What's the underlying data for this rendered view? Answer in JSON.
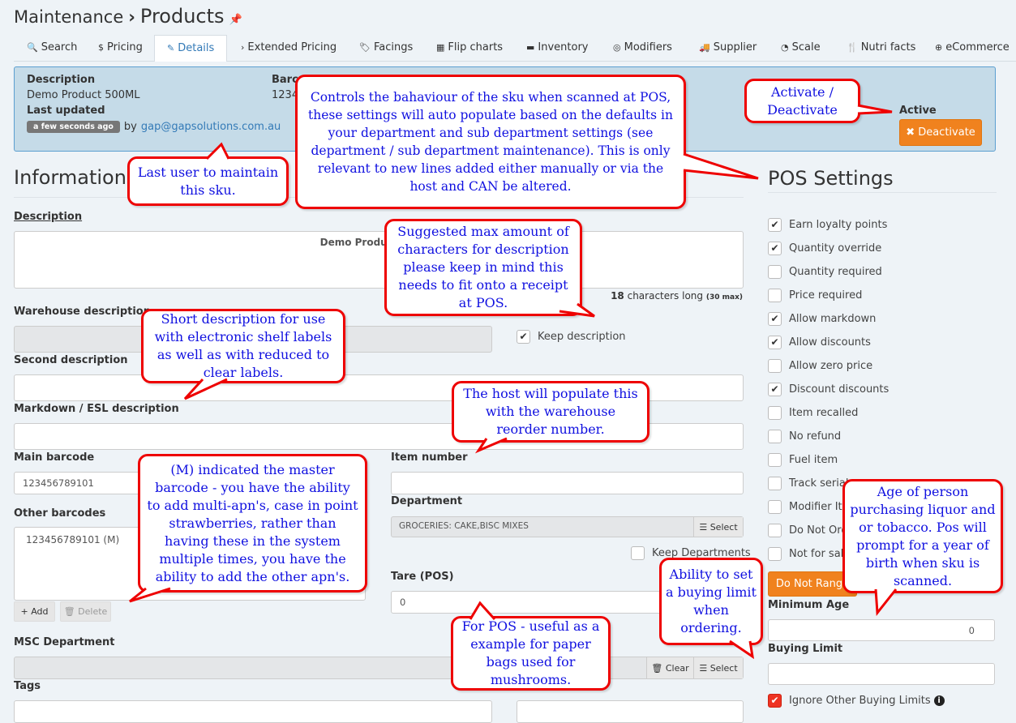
{
  "breadcrumb": {
    "parent": "Maintenance",
    "separator": "›",
    "current": "Products"
  },
  "tabs": [
    {
      "icon": "🔍",
      "label": "Search"
    },
    {
      "icon": "$",
      "label": "Pricing"
    },
    {
      "icon": "✎",
      "label": "Details"
    },
    {
      "icon": "›",
      "label": "Extended Pricing"
    },
    {
      "icon": "🏷",
      "label": "Facings"
    },
    {
      "icon": "▦",
      "label": "Flip charts"
    },
    {
      "icon": "▬",
      "label": "Inventory"
    },
    {
      "icon": "◎",
      "label": "Modifiers"
    },
    {
      "icon": "🚚",
      "label": "Supplier"
    },
    {
      "icon": "◔",
      "label": "Scale"
    },
    {
      "icon": "🍴",
      "label": "Nutri facts"
    },
    {
      "icon": "⊕",
      "label": "eCommerce"
    }
  ],
  "active_tab": "Details",
  "summary": {
    "description_label": "Description",
    "description": "Demo Product 500ML",
    "barcode_label": "Barcode",
    "barcode": "123456789101",
    "last_updated_label": "Last updated",
    "last_updated": "a few seconds ago",
    "by": "by",
    "user": "gap@gapsolutions.com.au",
    "status_label": "Active",
    "deactivate_button": "✖ Deactivate"
  },
  "information": {
    "title": "Information",
    "description_label": "Description",
    "description_value": "Demo Product 500ML",
    "char_count": "18",
    "char_text": "characters long",
    "char_max": "(30 max)",
    "warehouse_label": "Warehouse description",
    "keep_description": "Keep description",
    "second_label": "Second description",
    "markdown_label": "Markdown / ESL description",
    "main_barcode_label": "Main barcode",
    "main_barcode": "123456789101",
    "item_number_label": "Item number",
    "other_barcodes_label": "Other barcodes",
    "other_barcodes": [
      "123456789101 (M)"
    ],
    "add_button": "+ Add",
    "delete_button": "🗑 Delete",
    "department_label": "Department",
    "department": "GROCERIES: CAKE,BISC MIXES",
    "select_button": "☰ Select",
    "keep_departments": "Keep Departments",
    "tare_label": "Tare (POS)",
    "tare": "0",
    "msc_label": "MSC Department",
    "clear_button": "🗑 Clear",
    "tags_label": "Tags"
  },
  "pos": {
    "title": "POS Settings",
    "options": [
      {
        "label": "Earn loyalty points",
        "checked": true
      },
      {
        "label": "Quantity override",
        "checked": true
      },
      {
        "label": "Quantity required",
        "checked": false
      },
      {
        "label": "Price required",
        "checked": false
      },
      {
        "label": "Allow markdown",
        "checked": true
      },
      {
        "label": "Allow discounts",
        "checked": true
      },
      {
        "label": "Allow zero price",
        "checked": false
      },
      {
        "label": "Discount discounts",
        "checked": true
      },
      {
        "label": "Item recalled",
        "checked": false
      },
      {
        "label": "No refund",
        "checked": false
      },
      {
        "label": "Fuel item",
        "checked": false
      },
      {
        "label": "Track serial",
        "checked": false
      },
      {
        "label": "Modifier Ite",
        "checked": false
      },
      {
        "label": "Do Not Ord",
        "checked": false
      },
      {
        "label": "Not for sale",
        "checked": false
      }
    ],
    "do_not_range": "Do Not Range",
    "min_age_label": "Minimum Age",
    "min_age": "0",
    "buying_limit_label": "Buying Limit",
    "ignore_limits": "Ignore Other Buying Limits",
    "ignore_limits_checked": true
  },
  "callouts": {
    "pos_behaviour": "Controls the bahaviour of the sku when scanned at POS, these settings will auto populate based on the defaults in your department and sub department settings (see department / sub department maintenance).  This is only relevant to new lines added either manually or via the host and CAN be altered.",
    "activate": "Activate / Deactivate",
    "last_user": "Last user to maintain this sku.",
    "max_chars": "Suggested max amount of characters for description please keep in mind this needs to fit onto a receipt at POS.",
    "short_desc": "Short description for use with electronic shelf labels as well as with reduced to clear labels.",
    "host": "The host will populate this with the warehouse reorder number.",
    "master": "(M) indicated the master barcode - you have the ability to add multi-apn's, case in point strawberries, rather than having these in the system multiple times, you have the ability to add the other apn's.",
    "tare": "For POS - useful as a example for paper bags used for mushrooms.",
    "buying_limit": "Ability to set a buying limit when ordering.",
    "age": "Age of person purchasing liquor and or tobacco.  Pos will prompt for a year of birth when sku is scanned."
  },
  "colors": {
    "accent": "#337ab7",
    "orange": "#f0821e",
    "callout_border": "#ee0000",
    "callout_text": "#1010e0",
    "panel": "#c5dbe8"
  }
}
